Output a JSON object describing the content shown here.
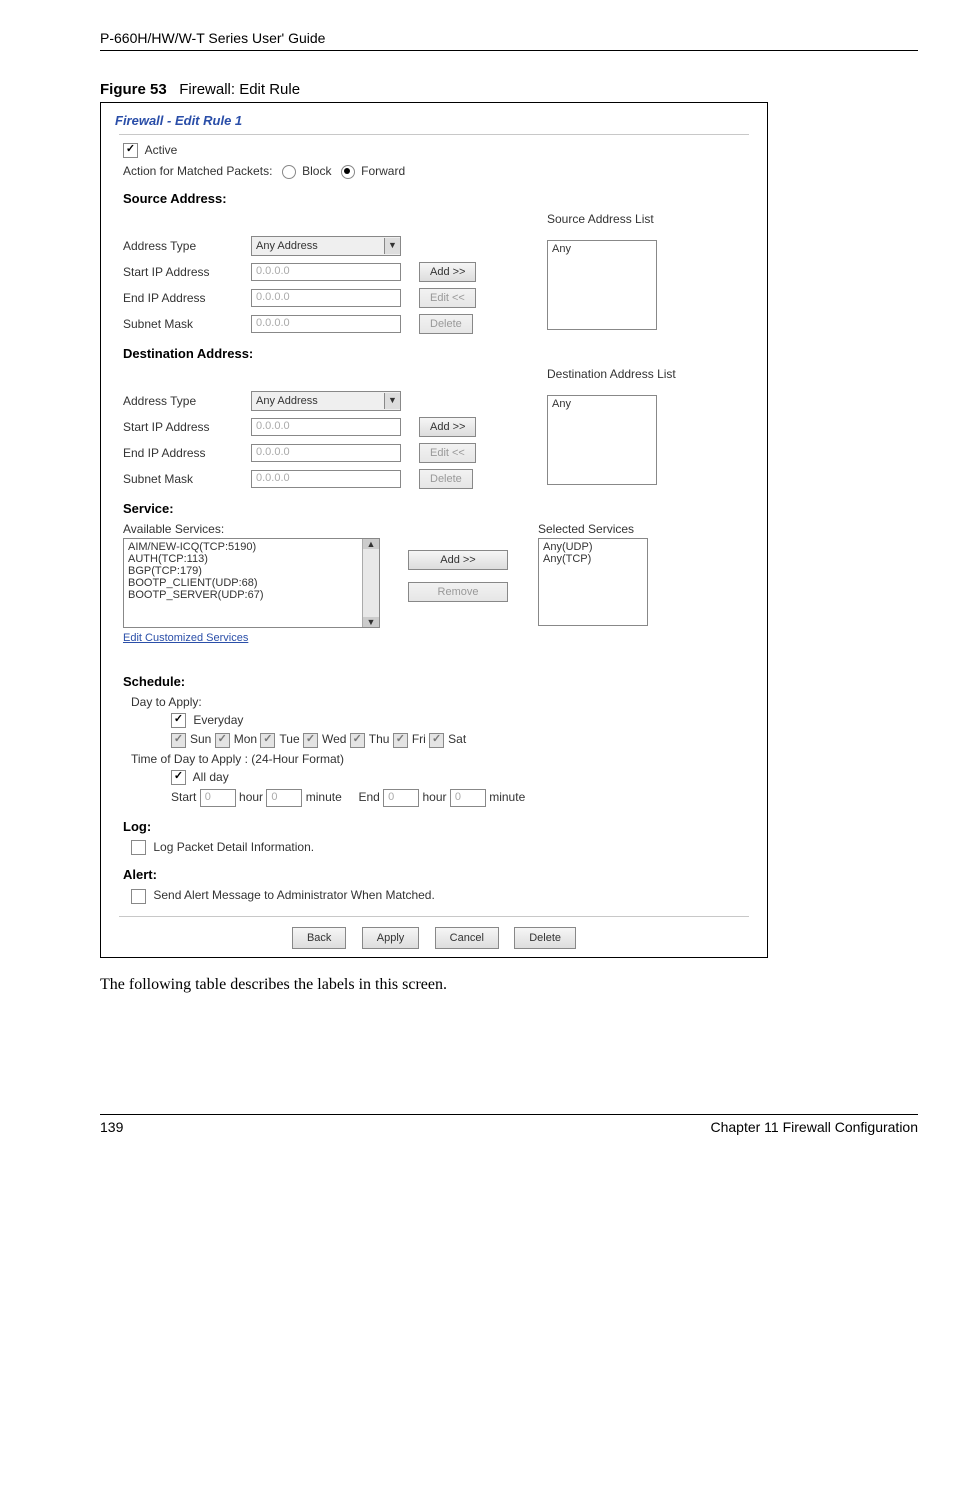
{
  "doc_header": "P-660H/HW/W-T Series User' Guide",
  "figure_label": "Figure 53",
  "figure_title": "Firewall: Edit Rule",
  "panel_title": "Firewall - Edit Rule 1",
  "active_label": "Active",
  "action_label": "Action for Matched Packets:",
  "action_block": "Block",
  "action_forward": "Forward",
  "source": {
    "heading": "Source Address:",
    "list_header": "Source Address List",
    "addr_type": "Address Type",
    "addr_type_val": "Any Address",
    "start_ip": "Start IP Address",
    "end_ip": "End IP Address",
    "subnet": "Subnet Mask",
    "ip_val": "0.0.0.0",
    "list_item": "Any"
  },
  "dest": {
    "heading": "Destination Address:",
    "list_header": "Destination Address List",
    "addr_type": "Address Type",
    "addr_type_val": "Any Address",
    "start_ip": "Start IP Address",
    "end_ip": "End IP Address",
    "subnet": "Subnet Mask",
    "ip_val": "0.0.0.0",
    "list_item": "Any"
  },
  "buttons": {
    "add": "Add >>",
    "edit": "Edit <<",
    "delete": "Delete",
    "remove": "Remove",
    "back": "Back",
    "apply": "Apply",
    "cancel": "Cancel"
  },
  "service": {
    "heading": "Service:",
    "avail_label": "Available Services:",
    "selected_label": "Selected Services",
    "avail_items": [
      "AIM/NEW-ICQ(TCP:5190)",
      "AUTH(TCP:113)",
      "BGP(TCP:179)",
      "BOOTP_CLIENT(UDP:68)",
      "BOOTP_SERVER(UDP:67)"
    ],
    "selected_items": [
      "Any(UDP)",
      "Any(TCP)"
    ],
    "edit_link": "Edit Customized Services"
  },
  "schedule": {
    "heading": "Schedule:",
    "day_label": "Day to Apply:",
    "everyday": "Everyday",
    "days": [
      "Sun",
      "Mon",
      "Tue",
      "Wed",
      "Thu",
      "Fri",
      "Sat"
    ],
    "time_label": "Time of Day to Apply : (24-Hour Format)",
    "allday": "All day",
    "start": "Start",
    "end": "End",
    "hour": "hour",
    "minute": "minute",
    "zero": "0"
  },
  "log": {
    "heading": "Log:",
    "label": "Log Packet Detail Information."
  },
  "alert": {
    "heading": "Alert:",
    "label": "Send Alert Message to Administrator When Matched."
  },
  "after_text": "The following table describes the labels in this screen.",
  "footer_left": "139",
  "footer_right": "Chapter 11 Firewall Configuration"
}
